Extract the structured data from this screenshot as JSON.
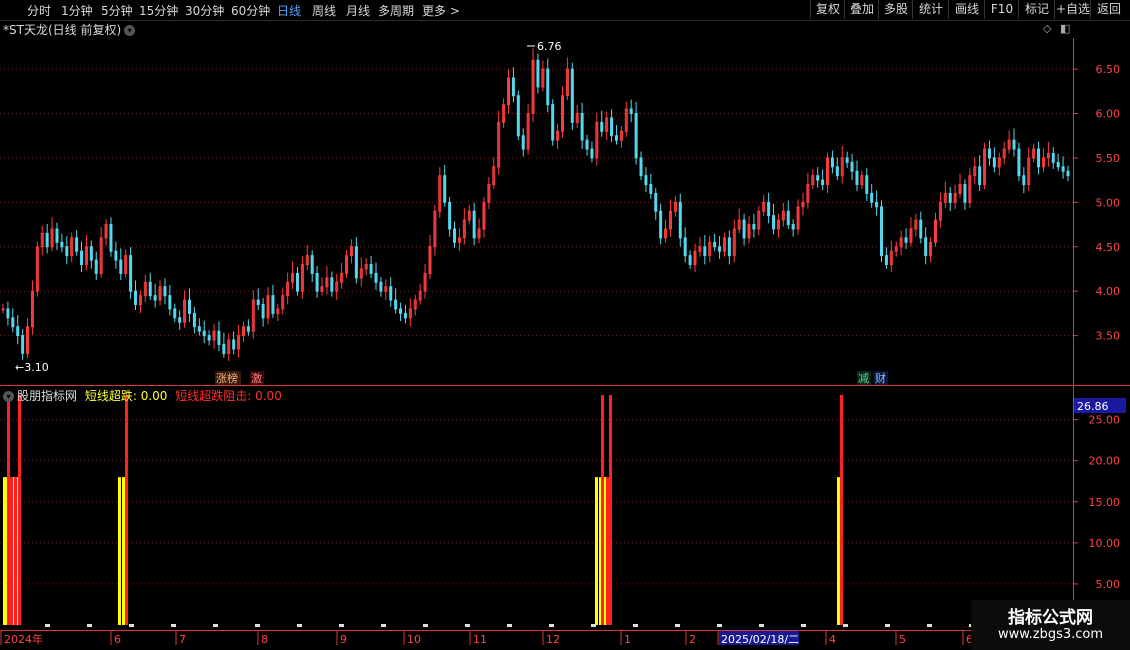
{
  "toolbar": {
    "periods": [
      "分时",
      "1分钟",
      "5分钟",
      "15分钟",
      "30分钟",
      "60分钟",
      "日线",
      "周线",
      "月线",
      "多周期",
      "更多 >"
    ],
    "active_period": "日线",
    "right_buttons": [
      "复权",
      "叠加",
      "多股",
      "统计",
      "画线",
      "F10",
      "标记",
      "+自选",
      "返回"
    ]
  },
  "main_title": "*ST天龙(日线 前复权)",
  "indicator_title": {
    "name": "股朋指标网",
    "item1_label": "短线超跌: 0.00",
    "item2_label": "短线超跌阻击: 0.00"
  },
  "price_axis_labels": [
    "6.50",
    "6.00",
    "5.50",
    "5.00",
    "4.50",
    "4.00",
    "3.50"
  ],
  "indicator_axis_labels": [
    "25.00",
    "20.00",
    "15.00",
    "10.00",
    "5.00"
  ],
  "indicator_current_value": "26.86",
  "high_marker": "6.76",
  "low_marker": "←3.10",
  "event_tags": [
    "涨榜",
    "激",
    "减",
    "财"
  ],
  "date_axis": [
    "2024年",
    "6",
    "7",
    "8",
    "9",
    "10",
    "11",
    "12",
    "1",
    "2",
    "2025/02/18/二",
    "4",
    "5",
    "6"
  ],
  "watermark": {
    "line1": "指标公式网",
    "line2": "www.zbgs3.com"
  },
  "colors": {
    "up": "#ff3d3d",
    "down": "#54d8f0",
    "yellow": "#ffff00",
    "grid": "#7a1c1c",
    "axis": "#d23c3c",
    "highlight_date_bg": "#1a1a90"
  },
  "chart_data": [
    {
      "type": "candlestick",
      "title": "*ST天龙(日线 前复权)",
      "ylim": [
        3.0,
        6.85
      ],
      "y_ticks": [
        3.5,
        4.0,
        4.5,
        5.0,
        5.5,
        6.0,
        6.5
      ],
      "x_ticks": [
        "2024年",
        "6",
        "7",
        "8",
        "9",
        "10",
        "11",
        "12",
        "1",
        "2",
        "2025/02/18/二",
        "4",
        "5",
        "6"
      ],
      "close": [
        3.8,
        3.7,
        3.6,
        3.5,
        3.3,
        3.6,
        4.0,
        4.5,
        4.65,
        4.5,
        4.7,
        4.55,
        4.5,
        4.4,
        4.6,
        4.45,
        4.3,
        4.5,
        4.35,
        4.2,
        4.6,
        4.75,
        4.45,
        4.35,
        4.2,
        4.4,
        4.0,
        3.85,
        3.95,
        4.1,
        3.95,
        3.9,
        4.05,
        3.95,
        3.8,
        3.7,
        3.65,
        3.9,
        3.75,
        3.6,
        3.55,
        3.5,
        3.45,
        3.55,
        3.4,
        3.3,
        3.45,
        3.35,
        3.5,
        3.6,
        3.55,
        3.9,
        3.85,
        3.7,
        3.95,
        3.75,
        3.8,
        3.95,
        4.1,
        4.2,
        4.0,
        4.3,
        4.4,
        4.2,
        4.0,
        4.05,
        4.15,
        4.0,
        4.1,
        4.2,
        4.4,
        4.5,
        4.15,
        4.25,
        4.3,
        4.2,
        4.1,
        4.0,
        4.05,
        3.9,
        3.8,
        3.75,
        3.7,
        3.8,
        3.9,
        4.0,
        4.2,
        4.5,
        4.9,
        5.3,
        5.0,
        4.7,
        4.55,
        4.6,
        4.8,
        4.9,
        4.6,
        4.7,
        5.0,
        5.2,
        5.4,
        5.9,
        6.1,
        6.4,
        6.2,
        5.75,
        5.6,
        6.0,
        6.6,
        6.3,
        6.5,
        6.1,
        5.7,
        5.8,
        6.2,
        6.5,
        5.9,
        6.0,
        5.7,
        5.6,
        5.5,
        5.9,
        5.8,
        5.95,
        5.75,
        5.7,
        5.8,
        6.05,
        6.0,
        5.5,
        5.3,
        5.2,
        5.1,
        4.9,
        4.6,
        4.7,
        4.9,
        5.0,
        4.6,
        4.4,
        4.3,
        4.45,
        4.5,
        4.4,
        4.55,
        4.5,
        4.45,
        4.6,
        4.4,
        4.7,
        4.8,
        4.6,
        4.75,
        4.7,
        4.9,
        5.0,
        4.85,
        4.7,
        4.8,
        4.9,
        4.75,
        4.7,
        4.95,
        5.0,
        5.2,
        5.3,
        5.25,
        5.2,
        5.5,
        5.4,
        5.3,
        5.5,
        5.45,
        5.35,
        5.2,
        5.3,
        5.1,
        5.0,
        4.95,
        4.4,
        4.3,
        4.45,
        4.5,
        4.6,
        4.55,
        4.7,
        4.8,
        4.6,
        4.4,
        4.55,
        4.8,
        5.0,
        5.1,
        5.0,
        5.1,
        5.2,
        5.0,
        5.3,
        5.4,
        5.2,
        5.6,
        5.5,
        5.4,
        5.5,
        5.6,
        5.7,
        5.6,
        5.3,
        5.2,
        5.5,
        5.6,
        5.4,
        5.5,
        5.55,
        5.45,
        5.4,
        5.35,
        5.3
      ]
    },
    {
      "type": "bar",
      "title": "股朋指标网",
      "ylim": [
        0,
        28
      ],
      "y_ticks": [
        5,
        10,
        15,
        20,
        25
      ],
      "series": [
        {
          "name": "短线超跌",
          "color": "#ffff00",
          "bars": [
            {
              "x": 3,
              "v": 18
            },
            {
              "x": 5,
              "v": 18
            },
            {
              "x": 12,
              "v": 18
            },
            {
              "x": 16,
              "v": 18
            },
            {
              "x": 118,
              "v": 18
            },
            {
              "x": 122,
              "v": 18
            },
            {
              "x": 595,
              "v": 18
            },
            {
              "x": 599,
              "v": 18
            },
            {
              "x": 603,
              "v": 18
            },
            {
              "x": 837,
              "v": 18
            }
          ]
        },
        {
          "name": "短线超跌阻击",
          "color": "#ff2020",
          "bars": [
            {
              "x": 7,
              "v": 28
            },
            {
              "x": 10,
              "v": 18
            },
            {
              "x": 14,
              "v": 18
            },
            {
              "x": 18,
              "v": 28
            },
            {
              "x": 125,
              "v": 28
            },
            {
              "x": 601,
              "v": 28
            },
            {
              "x": 606,
              "v": 18
            },
            {
              "x": 609,
              "v": 28
            },
            {
              "x": 840,
              "v": 28
            }
          ]
        }
      ]
    }
  ]
}
